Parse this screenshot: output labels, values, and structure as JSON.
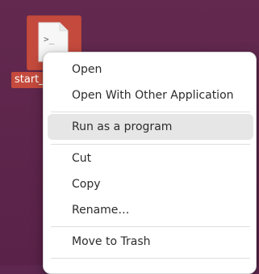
{
  "desktop": {
    "file": {
      "name": "start_",
      "icon": "terminal-script-file-icon",
      "glyph": ">_"
    }
  },
  "context_menu": {
    "items": [
      {
        "label": "Open"
      },
      {
        "label": "Open With Other Application"
      },
      {
        "label": "Run as a program",
        "hovered": true
      },
      {
        "label": "Cut"
      },
      {
        "label": "Copy"
      },
      {
        "label": "Rename…"
      },
      {
        "label": "Move to Trash"
      }
    ]
  },
  "colors": {
    "desktop_bg": "#5e2750",
    "selection": "#c44a3d",
    "menu_bg": "#ffffff",
    "menu_hover": "#e6e6e6",
    "text": "#2c2c2c"
  }
}
